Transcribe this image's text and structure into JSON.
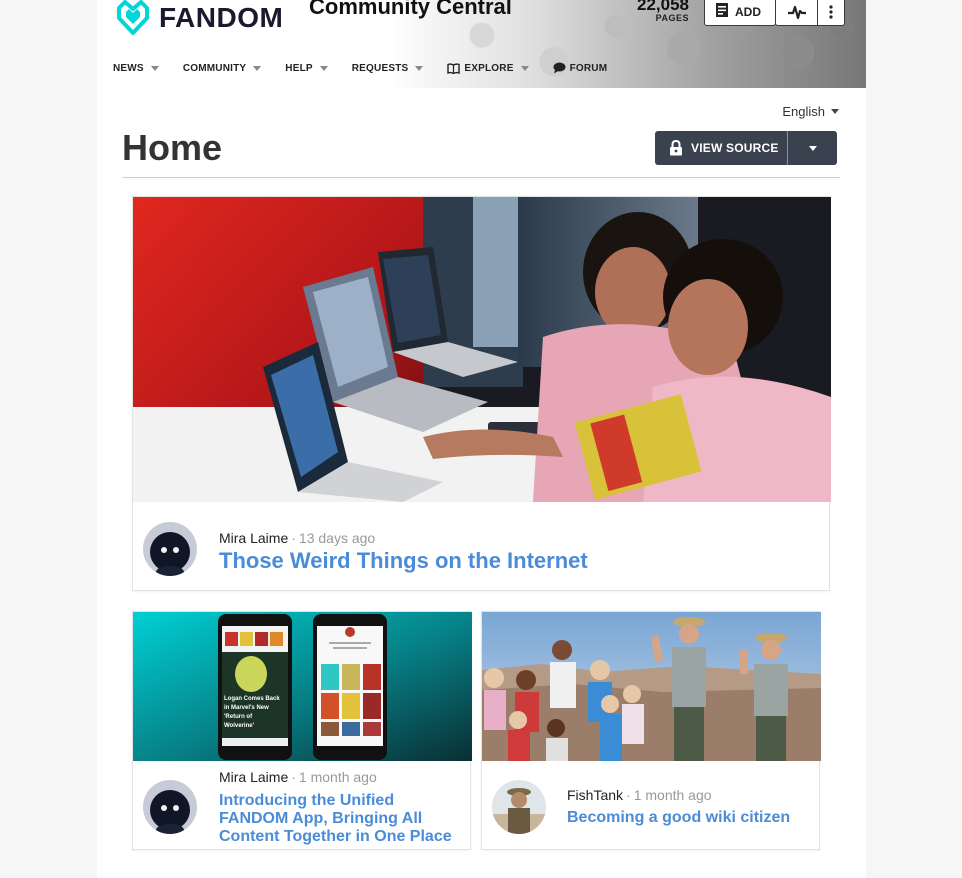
{
  "header": {
    "logo_text": "FANDOM",
    "wiki_name": "Community Central",
    "pages_count": "22,058",
    "pages_label": "PAGES",
    "add_label": "ADD",
    "nav": [
      {
        "label": "NEWS",
        "has_menu": true
      },
      {
        "label": "COMMUNITY",
        "has_menu": true
      },
      {
        "label": "HELP",
        "has_menu": true
      },
      {
        "label": "REQUESTS",
        "has_menu": true
      },
      {
        "label": "EXPLORE",
        "has_menu": true,
        "icon": "book-icon"
      },
      {
        "label": "FORUM",
        "has_menu": false,
        "icon": "speech-bubble-icon"
      }
    ]
  },
  "language": {
    "selected": "English"
  },
  "page": {
    "title": "Home",
    "view_source_label": "VIEW SOURCE"
  },
  "posts": [
    {
      "author": "Mira Laime",
      "time": "13 days ago",
      "title": "Those Weird Things on the Internet"
    },
    {
      "author": "Mira Laime",
      "time": "1 month ago",
      "title_lines": [
        "Introducing the Unified",
        "FANDOM App, Bringing All",
        "Content Together in One Place"
      ]
    },
    {
      "author": "FishTank",
      "time": "1 month ago",
      "title": "Becoming a good wiki citizen"
    }
  ],
  "app_screens": {
    "left_caption_lines": [
      "Logan Comes Back",
      "in Marvel's New",
      "'Return of",
      "Wolverine'"
    ]
  },
  "colors": {
    "brand_teal": "#00d6d6",
    "link_blue": "#4a8cd8",
    "button_dark": "#3a4250"
  }
}
